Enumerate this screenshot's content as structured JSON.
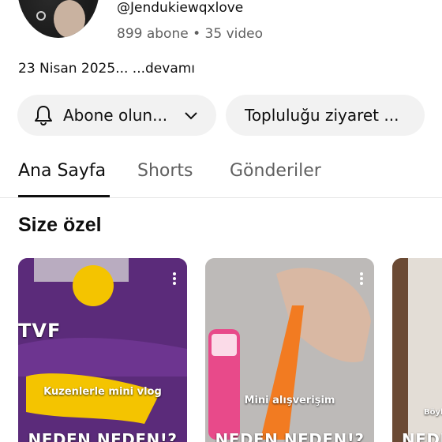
{
  "channel": {
    "handle": "@Jendukiewqxlove",
    "stats": "899 abone • 35 video",
    "description": "23 Nisan 2025... ...devamı"
  },
  "actions": {
    "subscribe_label": "Abone olun...",
    "community_label": "Topluluğu ziyaret ..."
  },
  "tabs": [
    {
      "label": "Ana Sayfa",
      "active": true
    },
    {
      "label": "Shorts",
      "active": false
    },
    {
      "label": "Gönderiler",
      "active": false
    }
  ],
  "section": {
    "title": "Size özel"
  },
  "shorts": [
    {
      "overlay_caption": "Kuzenlerle mini vlog",
      "partial_title": "NEDEN NEDEN!?",
      "background": "#5b2b7a"
    },
    {
      "overlay_caption": "Mini alışverişim",
      "partial_title": "NEDEN NEDEN!?",
      "background": "#bdbab8"
    },
    {
      "overlay_caption": "Böyle",
      "partial_title": "NEDEN",
      "background": "#6b4a34"
    }
  ],
  "icons": {
    "bell": "bell-icon",
    "chevron": "chevron-down-icon",
    "more": "more-vert-icon"
  }
}
